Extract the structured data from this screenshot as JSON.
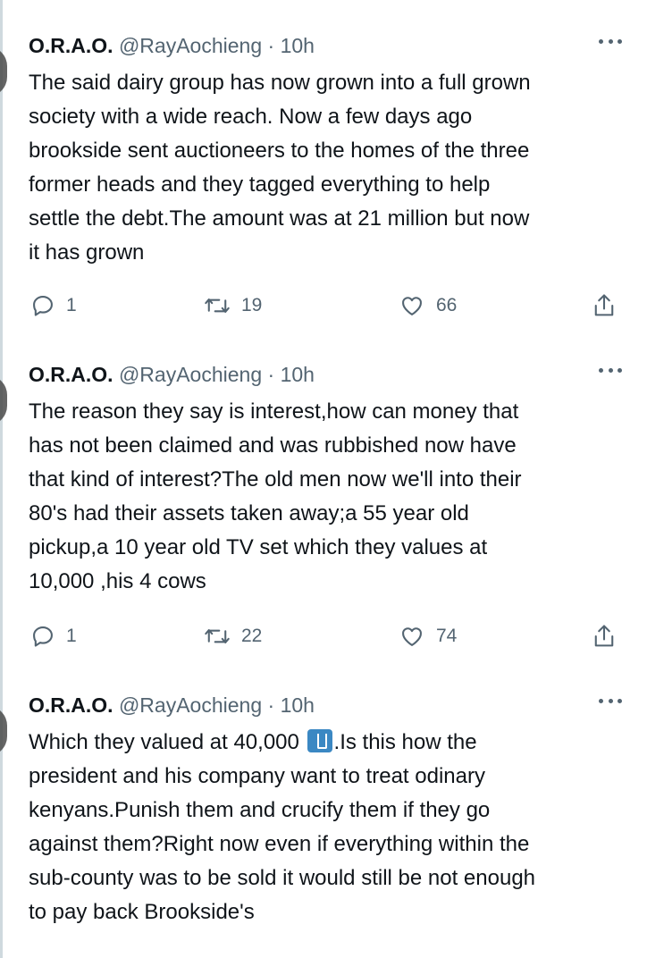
{
  "tweets": [
    {
      "name": "O.R.A.O.",
      "handle": "@RayAochieng",
      "separator": "·",
      "time": "10h",
      "lines": [
        "The said dairy group has now grown into a full grown",
        "society with a wide reach. Now a few days ago",
        "brookside sent auctioneers to the homes of the three",
        "former heads and they tagged everything to help",
        "settle the debt.The amount was at 21 million but now",
        "it has grown"
      ],
      "replies": "1",
      "retweets": "19",
      "likes": "66"
    },
    {
      "name": "O.R.A.O.",
      "handle": "@RayAochieng",
      "separator": "·",
      "time": "10h",
      "lines": [
        "The reason they say is interest,how can money that",
        "has not been claimed and was rubbished now  have",
        "that kind of interest?The old men now we'll into their",
        "80's had their assets taken away;a 55 year old",
        "pickup,a 10 year old TV set which they values at",
        "10,000 ,his 4 cows"
      ],
      "replies": "1",
      "retweets": "22",
      "likes": "74"
    },
    {
      "name": "O.R.A.O.",
      "handle": "@RayAochieng",
      "separator": "·",
      "time": "10h",
      "line1_before_emoji": "Which they valued at 40,000 ",
      "line1_after_emoji": ".Is this how the",
      "emoji_icon": "trash-bin-icon",
      "lines": [
        "president and his company want to treat odinary",
        "kenyans.Punish them and crucify them if they go",
        "against them?Right now even if everything within the",
        "sub-county was to be sold it would still be not enough",
        "to pay back Brookside's"
      ]
    }
  ],
  "colors": {
    "text": "#0f1419",
    "secondary": "#536471",
    "thread_line": "#cfd9de",
    "emoji_bg": "#3b88c3"
  }
}
